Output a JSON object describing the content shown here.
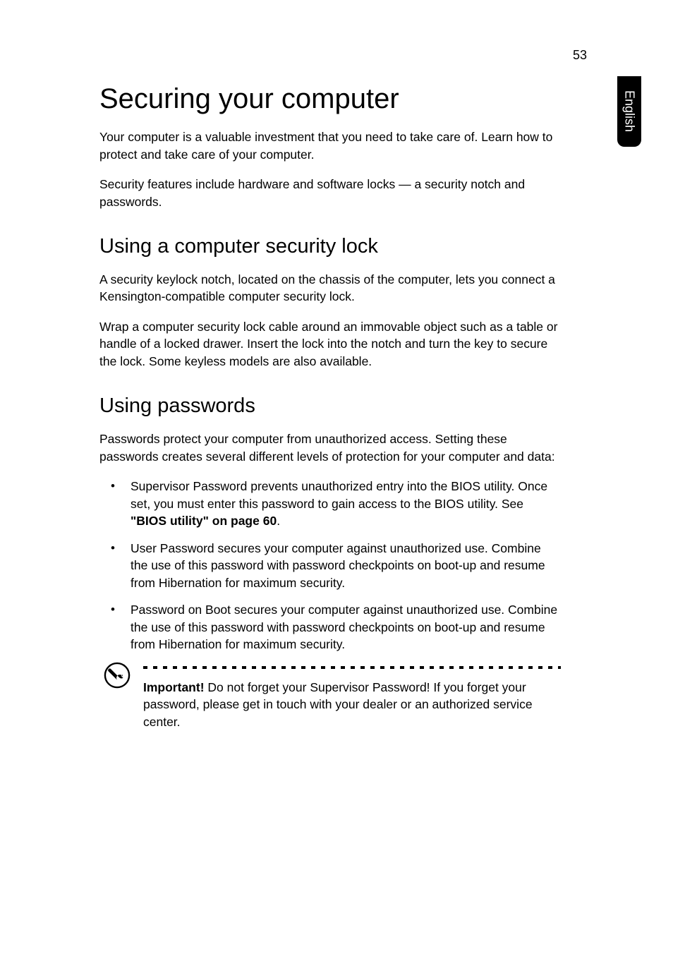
{
  "page_number": "53",
  "side_label": "English",
  "h1": "Securing your computer",
  "intro_p1": "Your computer is a valuable investment that you need to take care of. Learn how to protect and take care of your computer.",
  "intro_p2": "Security features include hardware and software locks — a security notch and passwords.",
  "h2a": "Using a computer security lock",
  "sec_a_p1": "A security keylock notch, located on the chassis of the computer, lets you connect a Kensington-compatible computer security lock.",
  "sec_a_p2": "Wrap a computer security lock cable around an immovable object such as a table or handle of a locked drawer. Insert the lock into the notch and turn the key to secure the lock. Some keyless models are also available.",
  "h2b": "Using passwords",
  "sec_b_p1": "Passwords protect your computer from unauthorized access. Setting these passwords creates several different levels of protection for your computer and data:",
  "bullets": {
    "b1_pre": "Supervisor Password prevents unauthorized entry into the BIOS utility. Once set, you must enter this password to gain access to the BIOS utility. See ",
    "b1_bold": "\"BIOS utility\" on page 60",
    "b1_post": ".",
    "b2": "User Password secures your computer against unauthorized use. Combine the use of this password with password checkpoints on boot-up and resume from Hibernation for maximum security.",
    "b3": "Password on Boot secures your computer against unauthorized use. Combine the use of this password with password checkpoints on boot-up and resume from Hibernation for maximum security."
  },
  "note": {
    "bold": "Important! ",
    "rest": "Do not forget your Supervisor Password! If you forget your password, please get in touch with your dealer or an authorized service center."
  }
}
